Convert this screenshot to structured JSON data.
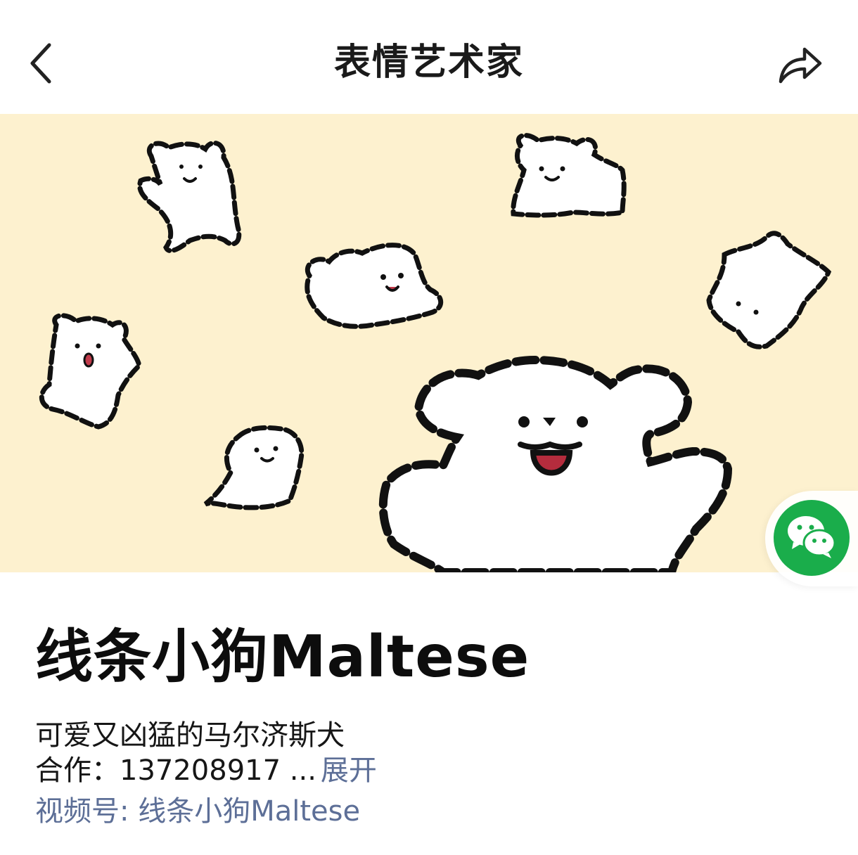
{
  "header": {
    "title": "表情艺术家",
    "back_icon": "chevron-left-icon",
    "share_icon": "share-arrow-icon"
  },
  "banner": {
    "background_color": "#fdf1cf",
    "illustration": "maltese-dogs-banner"
  },
  "wechat_button": {
    "icon": "wechat-icon",
    "color": "#1aad4b"
  },
  "sticker": {
    "name": "线条小狗Maltese",
    "description": "可爱又凶猛的马尔济斯犬",
    "collab_label": "合作：",
    "collab_value": "137208917 ...",
    "expand_label": "展开",
    "channel_prefix": "视频号: ",
    "channel_name": "线条小狗Maltese",
    "link_color": "#5d6f97"
  }
}
